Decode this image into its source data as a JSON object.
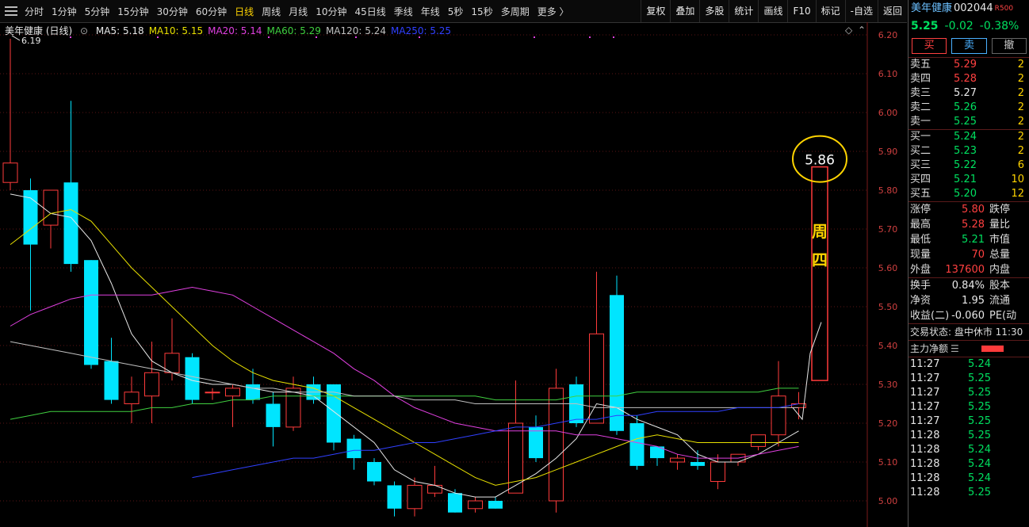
{
  "toolbar": {
    "periods": [
      {
        "label": "分时",
        "active": false
      },
      {
        "label": "1分钟",
        "active": false
      },
      {
        "label": "5分钟",
        "active": false
      },
      {
        "label": "15分钟",
        "active": false
      },
      {
        "label": "30分钟",
        "active": false
      },
      {
        "label": "60分钟",
        "active": false
      },
      {
        "label": "日线",
        "active": true
      },
      {
        "label": "周线",
        "active": false
      },
      {
        "label": "月线",
        "active": false
      },
      {
        "label": "10分钟",
        "active": false
      },
      {
        "label": "45日线",
        "active": false
      },
      {
        "label": "季线",
        "active": false
      },
      {
        "label": "年线",
        "active": false
      },
      {
        "label": "5秒",
        "active": false
      },
      {
        "label": "15秒",
        "active": false
      },
      {
        "label": "多周期",
        "active": false
      },
      {
        "label": "更多 〉",
        "active": false
      }
    ],
    "tools": [
      "复权",
      "叠加",
      "多股",
      "统计",
      "画线",
      "F10",
      "标记",
      "-自选",
      "返回"
    ]
  },
  "chart": {
    "stock_label": "美年健康 (日线)",
    "ma_legend": [
      {
        "text": "MA5: 5.18",
        "color": "#e8e8e8"
      },
      {
        "text": "MA10: 5.15",
        "color": "#e8e000"
      },
      {
        "text": "MA20: 5.14",
        "color": "#e040e0"
      },
      {
        "text": "MA60: 5.29",
        "color": "#40d040"
      },
      {
        "text": "MA120: 5.24",
        "color": "#c0c0c0"
      },
      {
        "text": "MA250: 5.25",
        "color": "#3040ff"
      }
    ],
    "price_labels": [
      "6.20",
      "6.10",
      "6.00",
      "5.90",
      "5.80",
      "5.70",
      "5.60",
      "5.50",
      "5.40",
      "5.30",
      "5.20",
      "5.10",
      "5.00"
    ],
    "high_marker": "6.19",
    "annotation_value": "5.86",
    "annotation_text": [
      "周",
      "四"
    ]
  },
  "chart_data": {
    "type": "candlestick",
    "ylim": [
      4.94,
      6.24
    ],
    "candles": [
      {
        "o": 5.82,
        "h": 6.19,
        "l": 5.8,
        "c": 5.87
      },
      {
        "o": 5.8,
        "h": 5.83,
        "l": 5.49,
        "c": 5.66
      },
      {
        "o": 5.71,
        "h": 5.8,
        "l": 5.65,
        "c": 5.8
      },
      {
        "o": 5.82,
        "h": 6.03,
        "l": 5.59,
        "c": 5.61
      },
      {
        "o": 5.62,
        "h": 5.62,
        "l": 5.34,
        "c": 5.35
      },
      {
        "o": 5.36,
        "h": 5.42,
        "l": 5.25,
        "c": 5.26
      },
      {
        "o": 5.25,
        "h": 5.32,
        "l": 5.2,
        "c": 5.28
      },
      {
        "o": 5.27,
        "h": 5.41,
        "l": 5.2,
        "c": 5.33
      },
      {
        "o": 5.33,
        "h": 5.47,
        "l": 5.31,
        "c": 5.38
      },
      {
        "o": 5.37,
        "h": 5.38,
        "l": 5.25,
        "c": 5.26
      },
      {
        "o": 5.28,
        "h": 5.29,
        "l": 5.26,
        "c": 5.28
      },
      {
        "o": 5.27,
        "h": 5.3,
        "l": 5.19,
        "c": 5.29
      },
      {
        "o": 5.3,
        "h": 5.34,
        "l": 5.25,
        "c": 5.26
      },
      {
        "o": 5.25,
        "h": 5.28,
        "l": 5.14,
        "c": 5.19
      },
      {
        "o": 5.19,
        "h": 5.32,
        "l": 5.18,
        "c": 5.29
      },
      {
        "o": 5.3,
        "h": 5.32,
        "l": 5.25,
        "c": 5.26
      },
      {
        "o": 5.3,
        "h": 5.3,
        "l": 5.13,
        "c": 5.15
      },
      {
        "o": 5.16,
        "h": 5.17,
        "l": 5.08,
        "c": 5.11
      },
      {
        "o": 5.1,
        "h": 5.11,
        "l": 5.04,
        "c": 5.05
      },
      {
        "o": 5.04,
        "h": 5.05,
        "l": 4.96,
        "c": 4.98
      },
      {
        "o": 4.98,
        "h": 5.06,
        "l": 4.96,
        "c": 5.04
      },
      {
        "o": 5.02,
        "h": 5.09,
        "l": 5.01,
        "c": 5.04
      },
      {
        "o": 5.02,
        "h": 5.03,
        "l": 4.97,
        "c": 4.97
      },
      {
        "o": 4.98,
        "h": 5.01,
        "l": 4.97,
        "c": 5.0
      },
      {
        "o": 5.0,
        "h": 5.01,
        "l": 4.98,
        "c": 4.98
      },
      {
        "o": 5.02,
        "h": 5.31,
        "l": 5.02,
        "c": 5.2
      },
      {
        "o": 5.19,
        "h": 5.22,
        "l": 5.1,
        "c": 5.11
      },
      {
        "o": 5.0,
        "h": 5.34,
        "l": 4.97,
        "c": 5.29
      },
      {
        "o": 5.3,
        "h": 5.32,
        "l": 5.19,
        "c": 5.2
      },
      {
        "o": 5.2,
        "h": 5.59,
        "l": 5.2,
        "c": 5.43
      },
      {
        "o": 5.53,
        "h": 5.58,
        "l": 5.17,
        "c": 5.18
      },
      {
        "o": 5.2,
        "h": 5.22,
        "l": 5.08,
        "c": 5.09
      },
      {
        "o": 5.14,
        "h": 5.14,
        "l": 5.09,
        "c": 5.11
      },
      {
        "o": 5.1,
        "h": 5.12,
        "l": 5.08,
        "c": 5.11
      },
      {
        "o": 5.1,
        "h": 5.13,
        "l": 5.08,
        "c": 5.09
      },
      {
        "o": 5.05,
        "h": 5.12,
        "l": 5.03,
        "c": 5.1
      },
      {
        "o": 5.1,
        "h": 5.12,
        "l": 5.09,
        "c": 5.12
      },
      {
        "o": 5.14,
        "h": 5.17,
        "l": 5.13,
        "c": 5.17
      },
      {
        "o": 5.17,
        "h": 5.36,
        "l": 5.14,
        "c": 5.27
      },
      {
        "o": 5.24,
        "h": 5.28,
        "l": 5.21,
        "c": 5.25
      }
    ],
    "ma": [
      {
        "name": "MA5",
        "color": "#e8e8e8",
        "values": [
          5.79,
          5.78,
          5.74,
          5.73,
          5.67,
          5.56,
          5.43,
          5.36,
          5.33,
          5.31,
          5.3,
          5.3,
          5.29,
          5.28,
          5.28,
          5.27,
          5.23,
          5.19,
          5.15,
          5.08,
          5.05,
          5.04,
          5.02,
          5.01,
          5.01,
          5.04,
          5.07,
          5.11,
          5.16,
          5.25,
          5.24,
          5.21,
          5.19,
          5.17,
          5.12,
          5.1,
          5.1,
          5.12,
          5.15,
          5.18
        ]
      },
      {
        "name": "MA10",
        "color": "#e8e000",
        "values": [
          5.66,
          5.7,
          5.74,
          5.75,
          5.72,
          5.66,
          5.6,
          5.55,
          5.5,
          5.45,
          5.4,
          5.36,
          5.33,
          5.31,
          5.3,
          5.29,
          5.27,
          5.24,
          5.21,
          5.18,
          5.15,
          5.12,
          5.09,
          5.06,
          5.04,
          5.05,
          5.06,
          5.08,
          5.1,
          5.12,
          5.14,
          5.16,
          5.17,
          5.16,
          5.15,
          5.15,
          5.15,
          5.15,
          5.15,
          5.15
        ]
      },
      {
        "name": "MA20",
        "color": "#e040e0",
        "values": [
          5.45,
          5.48,
          5.5,
          5.52,
          5.53,
          5.53,
          5.53,
          5.53,
          5.54,
          5.55,
          5.54,
          5.53,
          5.5,
          5.47,
          5.44,
          5.41,
          5.38,
          5.34,
          5.31,
          5.27,
          5.24,
          5.22,
          5.2,
          5.19,
          5.18,
          5.18,
          5.18,
          5.18,
          5.17,
          5.17,
          5.16,
          5.15,
          5.14,
          5.12,
          5.11,
          5.11,
          5.11,
          5.12,
          5.13,
          5.14
        ]
      },
      {
        "name": "MA60",
        "color": "#40d040",
        "values": [
          5.21,
          5.22,
          5.23,
          5.23,
          5.23,
          5.23,
          5.23,
          5.24,
          5.24,
          5.25,
          5.25,
          5.26,
          5.26,
          5.27,
          5.27,
          5.27,
          5.27,
          5.27,
          5.27,
          5.27,
          5.27,
          5.27,
          5.27,
          5.27,
          5.26,
          5.26,
          5.26,
          5.26,
          5.27,
          5.27,
          5.27,
          5.28,
          5.28,
          5.28,
          5.28,
          5.28,
          5.28,
          5.28,
          5.29,
          5.29
        ]
      },
      {
        "name": "MA120",
        "color": "#c0c0c0",
        "values": [
          5.41,
          5.4,
          5.39,
          5.38,
          5.37,
          5.36,
          5.35,
          5.34,
          5.33,
          5.32,
          5.31,
          5.3,
          5.29,
          5.29,
          5.28,
          5.28,
          5.28,
          5.27,
          5.27,
          5.27,
          5.26,
          5.26,
          5.26,
          5.25,
          5.25,
          5.25,
          5.25,
          5.25,
          5.25,
          5.24,
          5.24,
          5.24,
          5.24,
          5.24,
          5.24,
          5.24,
          5.24,
          5.24,
          5.24,
          5.24
        ]
      },
      {
        "name": "MA250",
        "color": "#3040ff",
        "values": [
          null,
          null,
          null,
          null,
          null,
          null,
          null,
          null,
          null,
          5.06,
          5.07,
          5.08,
          5.09,
          5.1,
          5.11,
          5.11,
          5.12,
          5.13,
          5.13,
          5.14,
          5.15,
          5.15,
          5.16,
          5.17,
          5.18,
          5.19,
          5.19,
          5.2,
          5.21,
          5.21,
          5.22,
          5.22,
          5.23,
          5.23,
          5.23,
          5.23,
          5.24,
          5.24,
          5.24,
          5.25
        ]
      }
    ],
    "annotation_bar": {
      "from": 5.31,
      "to": 5.86
    }
  },
  "panel": {
    "name": "美年健康",
    "code": "002044",
    "badge": "R500",
    "price": "5.25",
    "change": "-0.02",
    "change_pct": "-0.38%",
    "buy_label": "买",
    "sell_label": "卖",
    "cancel_label": "撤",
    "asks": [
      {
        "label": "卖五",
        "price": "5.29",
        "qty": "2",
        "color": "red"
      },
      {
        "label": "卖四",
        "price": "5.28",
        "qty": "2",
        "color": "red"
      },
      {
        "label": "卖三",
        "price": "5.27",
        "qty": "2",
        "color": "white"
      },
      {
        "label": "卖二",
        "price": "5.26",
        "qty": "2",
        "color": "green"
      },
      {
        "label": "卖一",
        "price": "5.25",
        "qty": "2",
        "color": "green"
      }
    ],
    "bids": [
      {
        "label": "买一",
        "price": "5.24",
        "qty": "2",
        "color": "green"
      },
      {
        "label": "买二",
        "price": "5.23",
        "qty": "2",
        "color": "green"
      },
      {
        "label": "买三",
        "price": "5.22",
        "qty": "6",
        "color": "green"
      },
      {
        "label": "买四",
        "price": "5.21",
        "qty": "10",
        "color": "green"
      },
      {
        "label": "买五",
        "price": "5.20",
        "qty": "12",
        "color": "green"
      }
    ],
    "stats": [
      {
        "l": "涨停",
        "v": "5.80",
        "vc": "red",
        "l2": "跌停"
      },
      {
        "l": "最高",
        "v": "5.28",
        "vc": "red",
        "l2": "量比"
      },
      {
        "l": "最低",
        "v": "5.21",
        "vc": "green",
        "l2": "市值"
      },
      {
        "l": "现量",
        "v": "70",
        "vc": "red",
        "l2": "总量"
      },
      {
        "l": "外盘",
        "v": "137600",
        "vc": "red",
        "l2": "内盘"
      }
    ],
    "stats2": [
      {
        "l": "换手",
        "v": "0.84%",
        "vc": "white",
        "l2": "股本"
      },
      {
        "l": "净资",
        "v": "1.95",
        "vc": "white",
        "l2": "流通"
      },
      {
        "l": "收益(二)",
        "v": "-0.060",
        "vc": "white",
        "l2": "PE(动"
      }
    ],
    "trading_state": "交易状态: 盘中休市 11:30",
    "main_flow_label": "主力净额",
    "ticks": [
      {
        "t": "11:27",
        "p": "5.24"
      },
      {
        "t": "11:27",
        "p": "5.25"
      },
      {
        "t": "11:27",
        "p": "5.25"
      },
      {
        "t": "11:27",
        "p": "5.25"
      },
      {
        "t": "11:27",
        "p": "5.25"
      },
      {
        "t": "11:28",
        "p": "5.25"
      },
      {
        "t": "11:28",
        "p": "5.24"
      },
      {
        "t": "11:28",
        "p": "5.24"
      },
      {
        "t": "11:28",
        "p": "5.24"
      },
      {
        "t": "11:28",
        "p": "5.25"
      }
    ]
  }
}
